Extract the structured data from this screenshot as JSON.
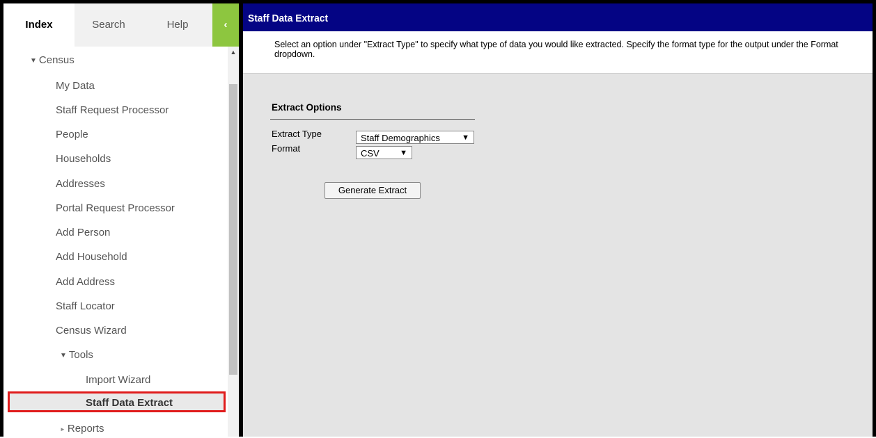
{
  "tabs": {
    "index": "Index",
    "search": "Search",
    "help": "Help",
    "collapse_glyph": "‹"
  },
  "nav": {
    "census": "Census",
    "expanded_arrow": "▼",
    "collapsed_arrow": "►",
    "items": [
      "My Data",
      "Staff Request Processor",
      "People",
      "Households",
      "Addresses",
      "Portal Request Processor",
      "Add Person",
      "Add Household",
      "Add Address",
      "Staff Locator",
      "Census Wizard"
    ],
    "tools": "Tools",
    "tools_items": [
      "Import Wizard",
      "Staff Data Extract"
    ],
    "reports": "Reports"
  },
  "main": {
    "title": "Staff Data Extract",
    "description": "Select an option under \"Extract Type\" to specify what type of data you would like extracted. Specify the format type for the output under the Format dropdown.",
    "section_title": "Extract Options",
    "extract_type_label": "Extract Type",
    "extract_type_value": "Staff Demographics",
    "format_label": "Format",
    "format_value": "CSV",
    "generate_button": "Generate Extract"
  },
  "icons": {
    "dropdown": "▼",
    "scroll_up": "▲"
  },
  "colors": {
    "title_bar": "#040484",
    "collapse_green": "#8dc63f",
    "highlight_red": "#e01b1b"
  }
}
